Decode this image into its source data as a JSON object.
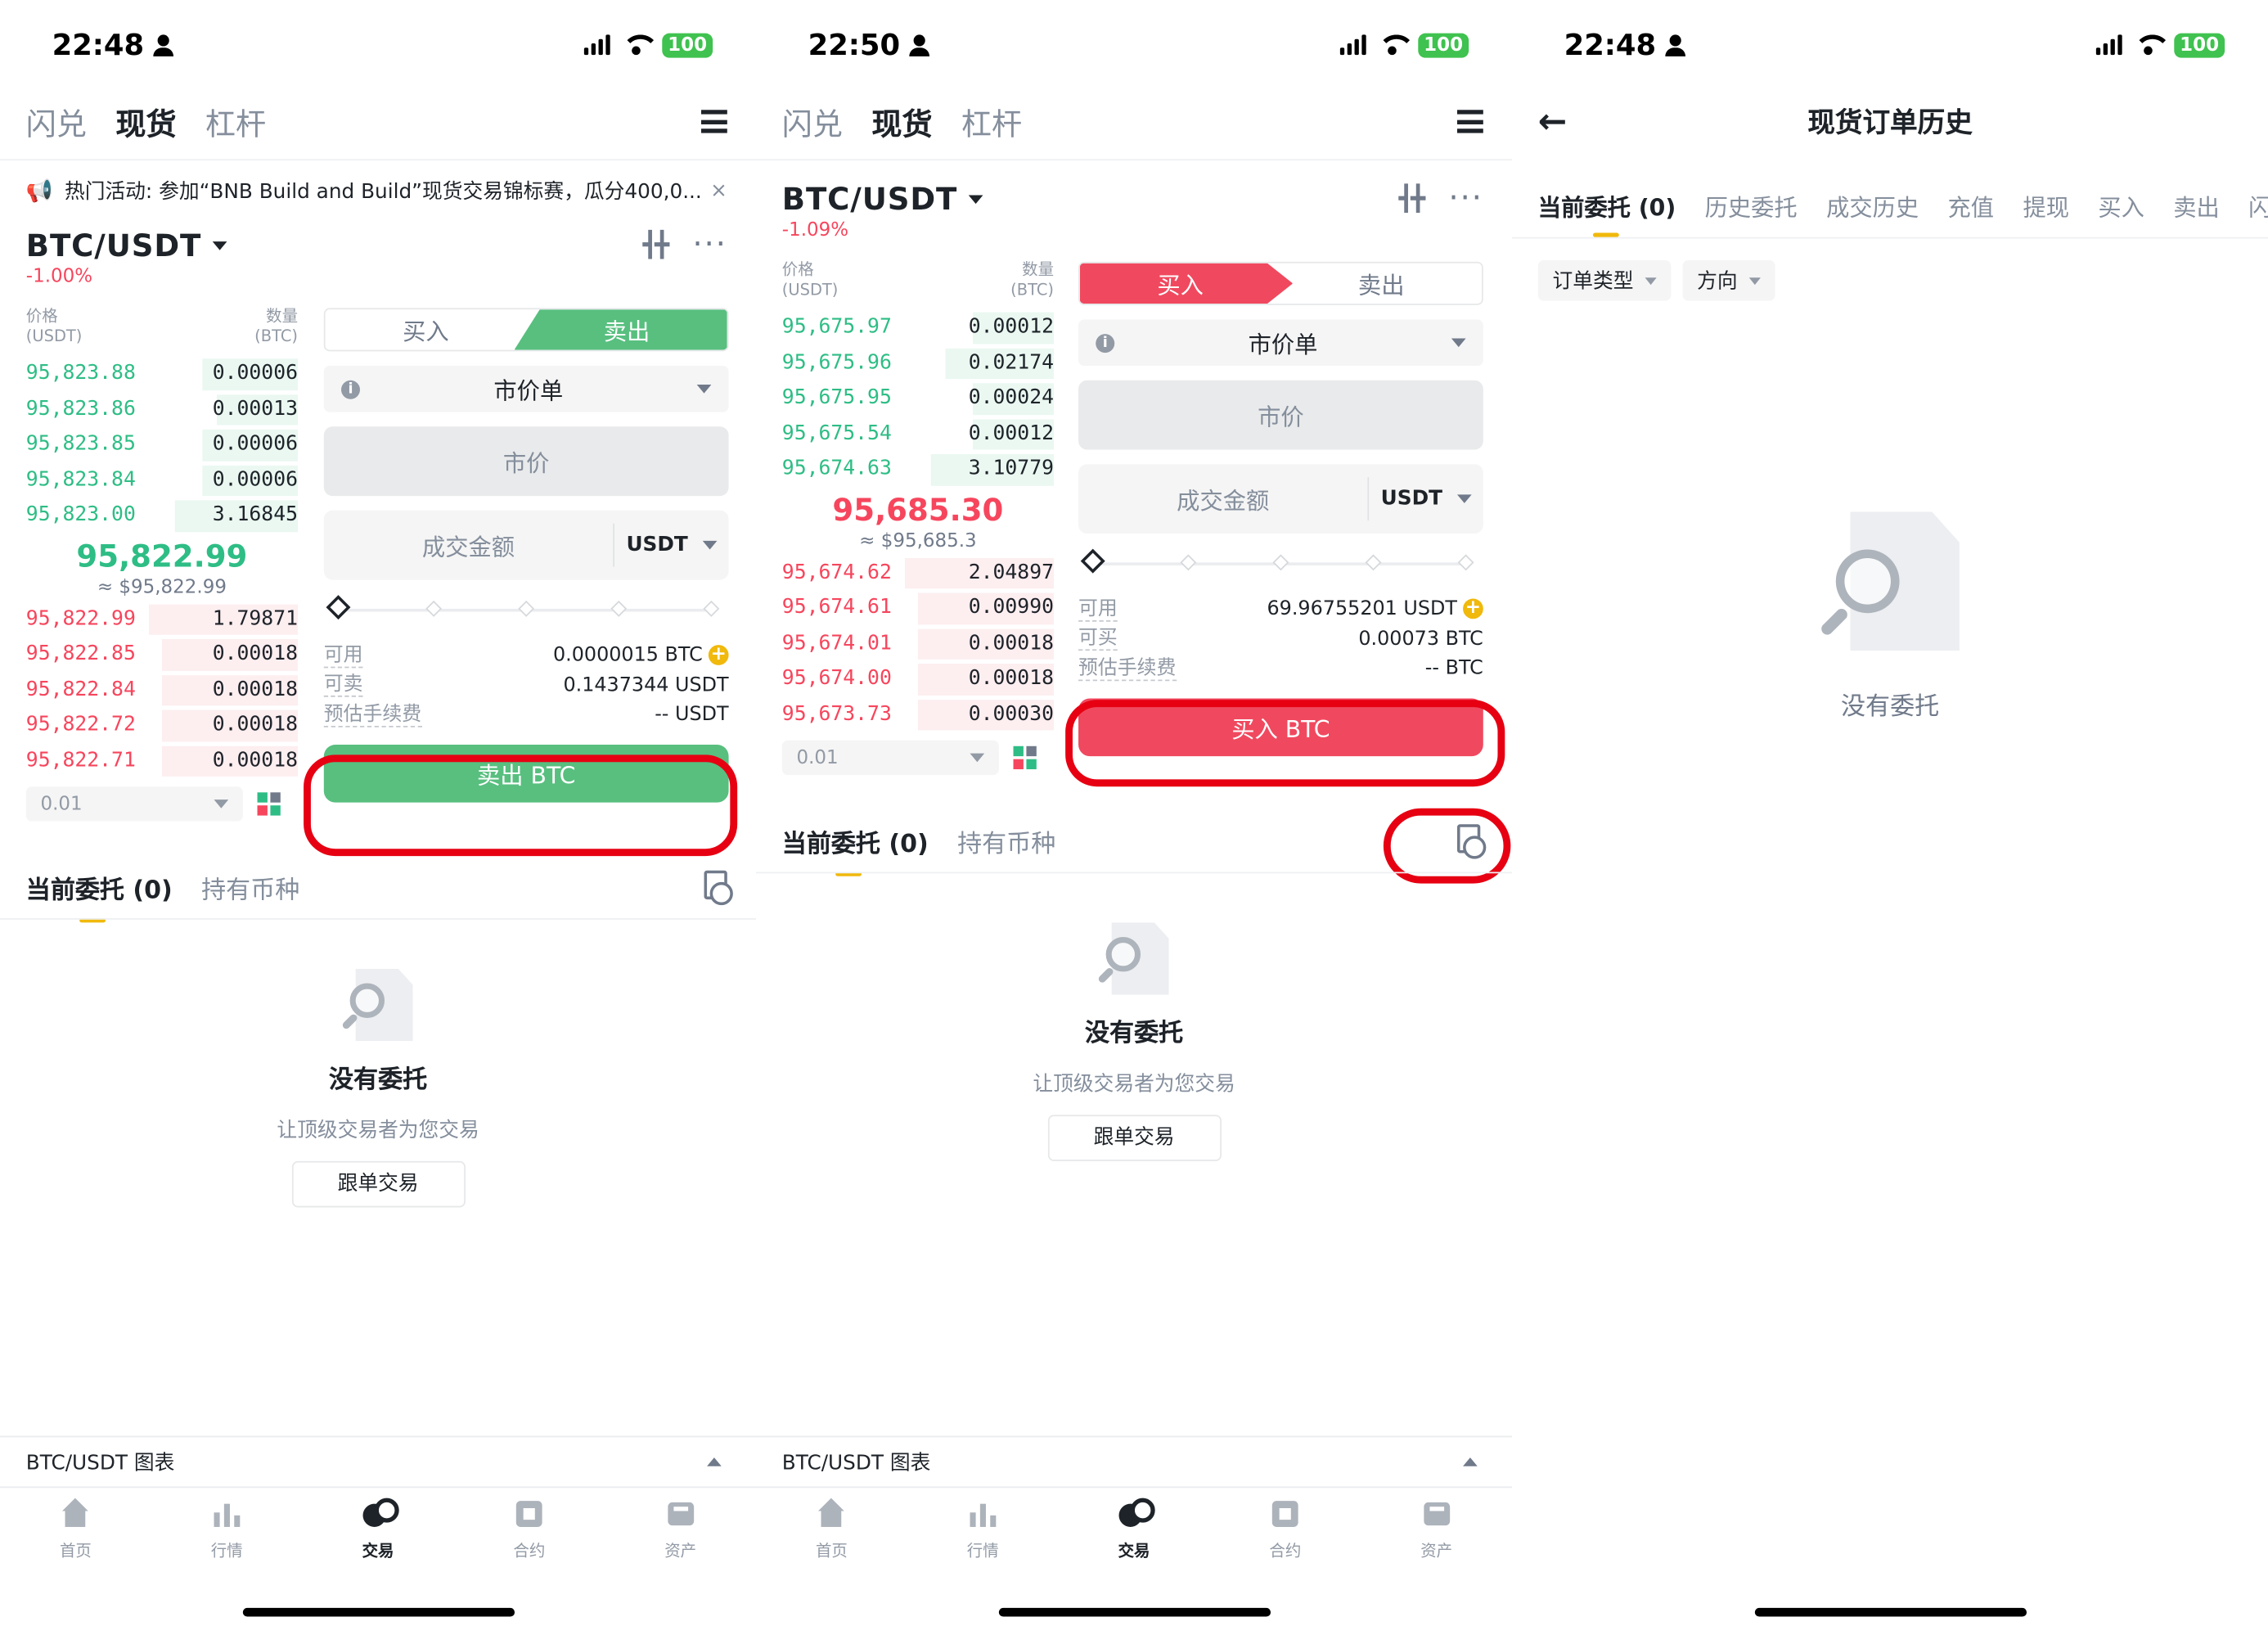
{
  "status": {
    "left_time": "22:48",
    "mid_time": "22:50",
    "right_time": "22:48",
    "battery": "100"
  },
  "nav": {
    "tab1": "闪兑",
    "tab2": "现货",
    "tab3": "杠杆"
  },
  "banner": {
    "text": "热门活动: 参加“BNB Build and Build”现货交易锦标赛，瓜分400,0...",
    "close": "×"
  },
  "sell_screen": {
    "pair": "BTC/USDT",
    "change": "-1.00%",
    "book_price_label": "价格",
    "book_price_unit": "(USDT)",
    "book_qty_label": "数量",
    "book_qty_unit": "(BTC)",
    "asks_green": [
      {
        "p": "95,823.88",
        "q": "0.00006",
        "w": 0.35
      },
      {
        "p": "95,823.86",
        "q": "0.00013",
        "w": 0.3
      },
      {
        "p": "95,823.85",
        "q": "0.00006",
        "w": 0.35
      },
      {
        "p": "95,823.84",
        "q": "0.00006",
        "w": 0.35
      },
      {
        "p": "95,823.00",
        "q": "3.16845",
        "w": 0.45
      }
    ],
    "mid_price": "95,822.99",
    "mid_usd": "≈ $95,822.99",
    "bids_red": [
      {
        "p": "95,822.99",
        "q": "1.79871",
        "w": 0.55
      },
      {
        "p": "95,822.85",
        "q": "0.00018",
        "w": 0.5
      },
      {
        "p": "95,822.84",
        "q": "0.00018",
        "w": 0.5
      },
      {
        "p": "95,822.72",
        "q": "0.00018",
        "w": 0.5
      },
      {
        "p": "95,822.71",
        "q": "0.00018",
        "w": 0.5
      }
    ],
    "depth": "0.01",
    "buy_tab": "买入",
    "sell_tab": "卖出",
    "order_type": "市价单",
    "market_label": "市价",
    "amount_label": "成交金额",
    "amount_unit": "USDT",
    "avail_label": "可用",
    "avail_value": "0.0000015 BTC",
    "sellable_label": "可卖",
    "sellable_value": "0.1437344 USDT",
    "fee_label": "预估手续费",
    "fee_value": "-- USDT",
    "action": "卖出 BTC"
  },
  "buy_screen": {
    "pair": "BTC/USDT",
    "change": "-1.09%",
    "asks_green": [
      {
        "p": "95,675.97",
        "q": "0.00012",
        "w": 0.3
      },
      {
        "p": "95,675.96",
        "q": "0.02174",
        "w": 0.4
      },
      {
        "p": "95,675.95",
        "q": "0.00024",
        "w": 0.3
      },
      {
        "p": "95,675.54",
        "q": "0.00012",
        "w": 0.3
      },
      {
        "p": "95,674.63",
        "q": "3.10779",
        "w": 0.45
      }
    ],
    "mid_price": "95,685.30",
    "mid_usd": "≈ $95,685.3",
    "bids_red": [
      {
        "p": "95,674.62",
        "q": "2.04897",
        "w": 0.55
      },
      {
        "p": "95,674.61",
        "q": "0.00990",
        "w": 0.5
      },
      {
        "p": "95,674.01",
        "q": "0.00018",
        "w": 0.5
      },
      {
        "p": "95,674.00",
        "q": "0.00018",
        "w": 0.5
      },
      {
        "p": "95,673.73",
        "q": "0.00030",
        "w": 0.5
      }
    ],
    "depth": "0.01",
    "avail_label": "可用",
    "avail_value": "69.96755201 USDT",
    "buyable_label": "可买",
    "buyable_value": "0.00073 BTC",
    "fee_label": "预估手续费",
    "fee_value": "-- BTC",
    "action": "买入 BTC"
  },
  "orders": {
    "current_tab": "当前委托 (0)",
    "holdings_tab": "持有币种",
    "empty_title": "没有委托",
    "empty_sub": "让顶级交易者为您交易",
    "follow_button": "跟单交易"
  },
  "chart_bar": "BTC/USDT 图表",
  "tabbar": {
    "home": "首页",
    "market": "行情",
    "trade": "交易",
    "futures": "合约",
    "assets": "资产"
  },
  "history_screen": {
    "title": "现货订单历史",
    "tabs": [
      "当前委托 (0)",
      "历史委托",
      "成交历史",
      "充值",
      "提现",
      "买入",
      "卖出",
      "闪"
    ],
    "filter_type": "订单类型",
    "filter_dir": "方向",
    "empty": "没有委托"
  },
  "colors": {
    "green": "#2ebd85",
    "red": "#f6465d",
    "sell_button": "#58bf7f",
    "buy_button": "#f0495f",
    "highlight": "#e60012",
    "accent": "#f0b90b"
  }
}
